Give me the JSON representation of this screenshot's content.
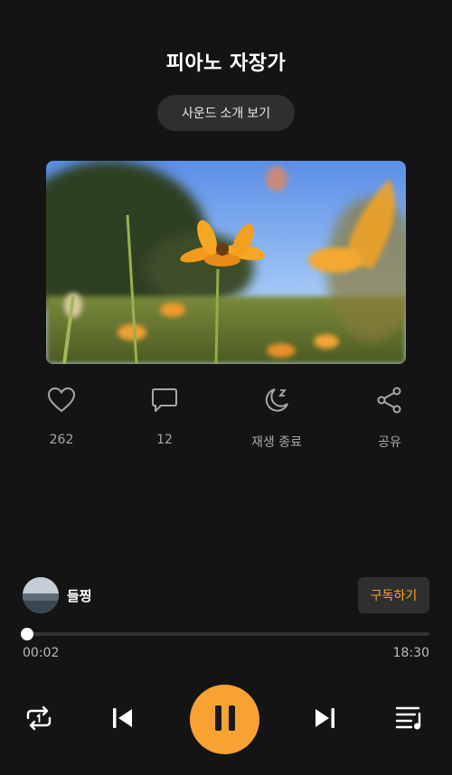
{
  "header": {
    "title": "피아노 자장가"
  },
  "intro_button": {
    "label": "사운드 소개 보기"
  },
  "actions": [
    {
      "icon": "heart-icon",
      "label": "262"
    },
    {
      "icon": "comment-icon",
      "label": "12"
    },
    {
      "icon": "moon-sleep-icon",
      "label": "재생 종료"
    },
    {
      "icon": "share-icon",
      "label": "공유"
    }
  ],
  "channel": {
    "name": "들찡",
    "subscribe_label": "구독하기"
  },
  "player": {
    "current_time": "00:02",
    "total_time": "18:30",
    "progress": 0.002
  },
  "colors": {
    "accent": "#f8a234",
    "background": "#141414"
  }
}
